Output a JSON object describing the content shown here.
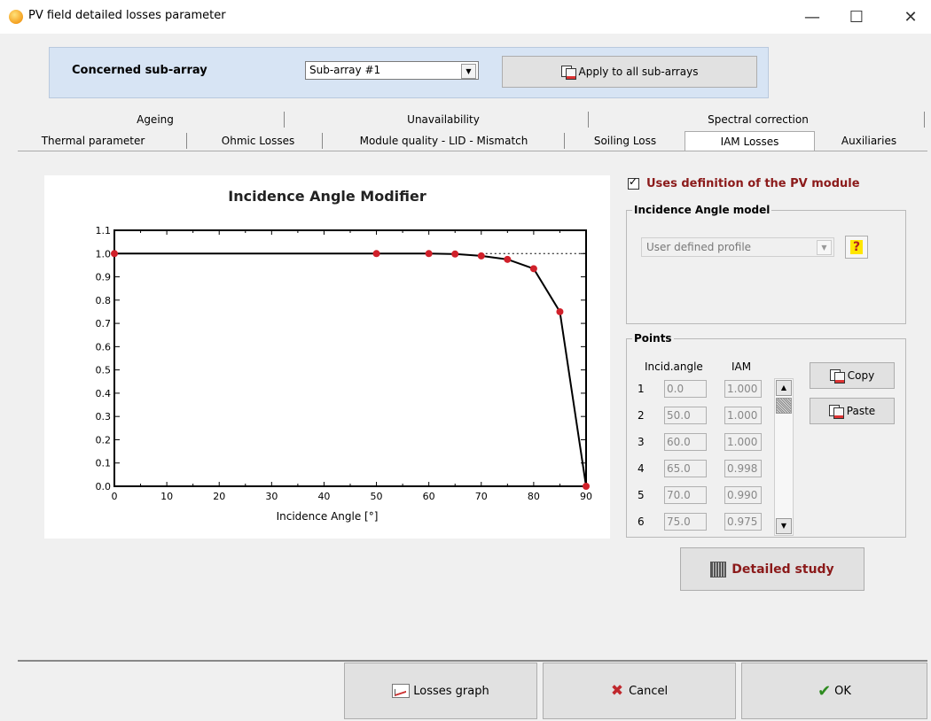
{
  "window": {
    "title": "PV field detailed losses parameter",
    "minimize": "—",
    "maximize": "☐",
    "close": "✕"
  },
  "subarray": {
    "label": "Concerned sub-array",
    "selected": "Sub-array #1",
    "apply_label": "Apply to all sub-arrays"
  },
  "tabs": {
    "row1": [
      "Ageing",
      "Unavailability",
      "Spectral correction"
    ],
    "row2": [
      "Thermal parameter",
      "Ohmic Losses",
      "Module quality - LID - Mismatch",
      "Soiling Loss",
      "IAM Losses",
      "Auxiliaries"
    ],
    "active": "IAM Losses"
  },
  "chart_data": {
    "type": "line",
    "title": "Incidence Angle Modifier",
    "xlabel": "Incidence Angle [°]",
    "ylabel": "",
    "xlim": [
      0,
      90
    ],
    "ylim": [
      0,
      1.1
    ],
    "xticks": [
      "0",
      "10",
      "20",
      "30",
      "40",
      "50",
      "60",
      "70",
      "80",
      "90"
    ],
    "yticks": [
      "0.0",
      "0.1",
      "0.2",
      "0.3",
      "0.4",
      "0.5",
      "0.6",
      "0.7",
      "0.8",
      "0.9",
      "1.0",
      "1.1"
    ],
    "points": [
      [
        0,
        1.0
      ],
      [
        50,
        1.0
      ],
      [
        60,
        1.0
      ],
      [
        65,
        0.998
      ],
      [
        70,
        0.99
      ],
      [
        75,
        0.975
      ],
      [
        80,
        0.935
      ],
      [
        85,
        0.75
      ],
      [
        90,
        0.0
      ]
    ],
    "reference_line": 1.0,
    "line_color": "#000000",
    "marker_color": "#d0202a"
  },
  "uses_def": {
    "label": "Uses definition of the PV module",
    "checked": true
  },
  "iam_model": {
    "legend": "Incidence Angle model",
    "selected": "User defined profile",
    "help": "?"
  },
  "points_group": {
    "legend": "Points",
    "col_angle": "Incid.angle",
    "col_iam": "IAM",
    "rows": [
      {
        "idx": "1",
        "angle": "0.0",
        "iam": "1.000"
      },
      {
        "idx": "2",
        "angle": "50.0",
        "iam": "1.000"
      },
      {
        "idx": "3",
        "angle": "60.0",
        "iam": "1.000"
      },
      {
        "idx": "4",
        "angle": "65.0",
        "iam": "0.998"
      },
      {
        "idx": "5",
        "angle": "70.0",
        "iam": "0.990"
      },
      {
        "idx": "6",
        "angle": "75.0",
        "iam": "0.975"
      }
    ],
    "copy_label": "Copy",
    "paste_label": "Paste"
  },
  "detailed_study_label": "Detailed study",
  "bottom": {
    "graph_label": "Losses graph",
    "cancel_label": "Cancel",
    "ok_label": "OK"
  }
}
